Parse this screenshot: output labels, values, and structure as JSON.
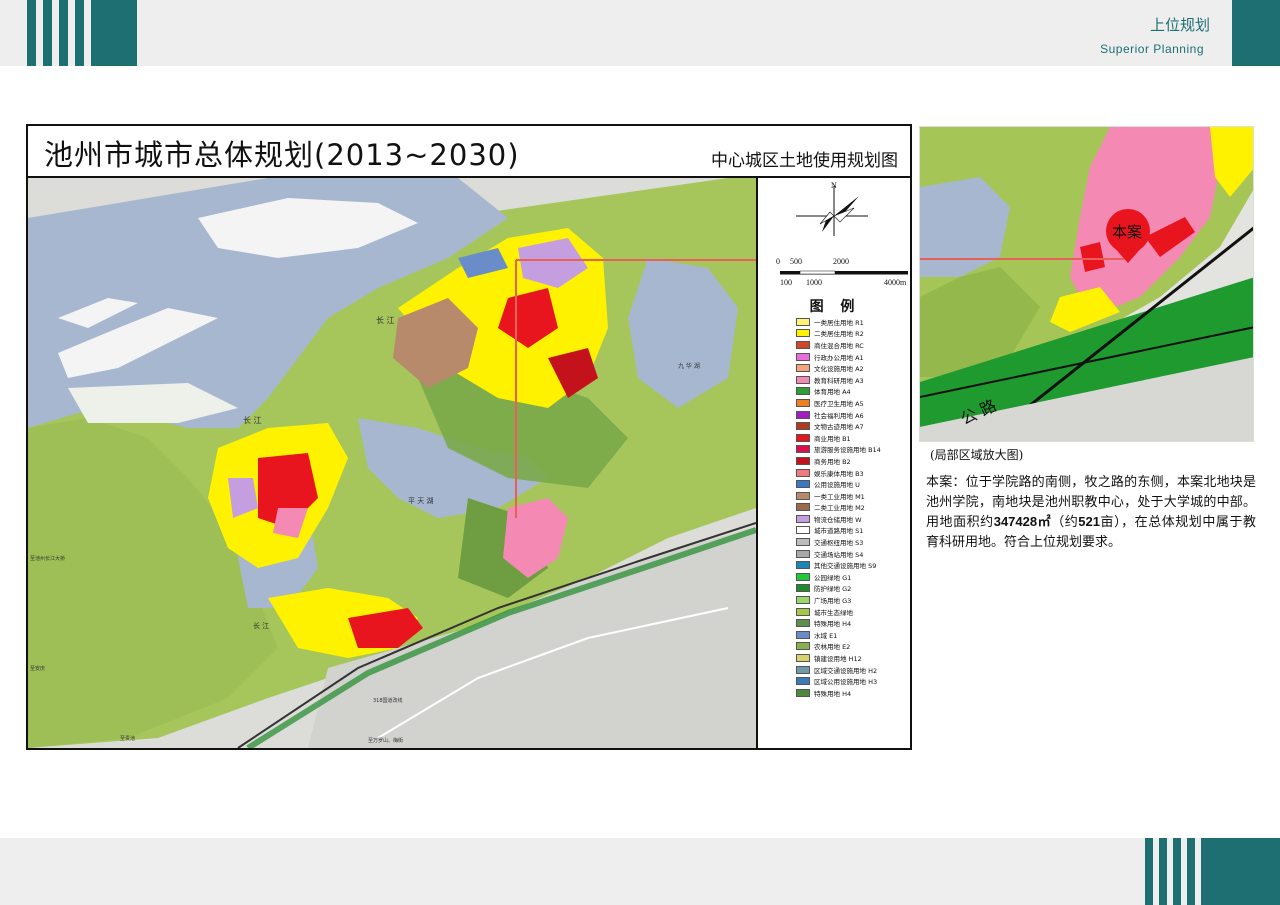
{
  "header": {
    "title_cn": "上位规划",
    "title_en": "Superior Planning"
  },
  "plan": {
    "title": "池州市城市总体规划(2013~2030)",
    "subtitle": "中心城区土地使用规划图",
    "map_labels": {
      "yangtze_1": "长 江",
      "yangtze_2": "长 江",
      "yangtze_3": "长 江",
      "pingtian_lake": "平 天 湖",
      "jiuhua_lake": "九 华 湖",
      "bridge": "至池州长江大桥",
      "guichi": "至贵池",
      "anqing": "至安庆",
      "wanfo": "至万罗山、梅街",
      "highway": "318国道改线"
    },
    "north_label": "N",
    "scale": {
      "top_ticks": [
        "0",
        "500",
        "2000"
      ],
      "bottom_ticks": [
        "100",
        "1000",
        "4000m"
      ]
    },
    "legend_title": "图 例",
    "legend": [
      {
        "label": "一类居住用地 R1",
        "color": "#fff275"
      },
      {
        "label": "二类居住用地 R2",
        "color": "#fff200"
      },
      {
        "label": "商住混合用地 RC",
        "color": "#d0472a"
      },
      {
        "label": "行政办公用地 A1",
        "color": "#e86ee0"
      },
      {
        "label": "文化设施用地 A2",
        "color": "#f5a37a"
      },
      {
        "label": "教育科研用地 A3",
        "color": "#f48ab4"
      },
      {
        "label": "体育用地 A4",
        "color": "#2d9e3a"
      },
      {
        "label": "医疗卫生用地 A5",
        "color": "#f07f22"
      },
      {
        "label": "社会福利用地 A6",
        "color": "#a01fc4"
      },
      {
        "label": "文物古迹用地 A7",
        "color": "#b23a20"
      },
      {
        "label": "商业用地 B1",
        "color": "#e8141e"
      },
      {
        "label": "旅游服务设施用地 B14",
        "color": "#d9114f"
      },
      {
        "label": "商务用地 B2",
        "color": "#c4121c"
      },
      {
        "label": "娱乐康体用地 B3",
        "color": "#f07b7b"
      },
      {
        "label": "公用设施用地 U",
        "color": "#3a78c4"
      },
      {
        "label": "一类工业用地 M1",
        "color": "#b88a6c"
      },
      {
        "label": "二类工业用地 M2",
        "color": "#9a6b4c"
      },
      {
        "label": "物流仓储用地 W",
        "color": "#c59ee0"
      },
      {
        "label": "城市道路用地 S1",
        "color": "#ffffff"
      },
      {
        "label": "交通枢纽用地 S3",
        "color": "#bdbdbd"
      },
      {
        "label": "交通场站用地 S4",
        "color": "#a9a9a9"
      },
      {
        "label": "其他交通设施用地 S9",
        "color": "#1a86b8"
      },
      {
        "label": "公园绿地 G1",
        "color": "#22c93a"
      },
      {
        "label": "防护绿地 G2",
        "color": "#1e8a2a"
      },
      {
        "label": "广场用地 G3",
        "color": "#9ad86b"
      },
      {
        "label": "城市生态绿地",
        "color": "#a6c84a"
      },
      {
        "label": "特殊用地 H4",
        "color": "#5f8f4a"
      },
      {
        "label": "水域 E1",
        "color": "#6a8dc9"
      },
      {
        "label": "农林用地 E2",
        "color": "#8ab04e"
      },
      {
        "label": "镇建设用地 H12",
        "color": "#d8d46a"
      },
      {
        "label": "区域交通设施用地 H2",
        "color": "#6f9aa8"
      },
      {
        "label": "区域公用设施用地 H3",
        "color": "#3c7ab8"
      },
      {
        "label": "特殊用地 H4",
        "color": "#4e8a3a"
      }
    ]
  },
  "zoom": {
    "pin_label": "本案",
    "road_label": "公 路",
    "caption": "(局部区域放大图)"
  },
  "description": {
    "line_a": "本案：位于学院路的南侧，牧之路的东侧，本案北地块是池州学院，南地块是池州职教中心，处于大学城的中部。用地面积约",
    "area": "347428㎡",
    "line_b": "（约",
    "mu": "521",
    "line_c": "亩），在总体规划中属于教育科研用地。符合上位规划要求。"
  },
  "colors": {
    "brand": "#1d6f72",
    "water": "#a6b7cf",
    "green": "#a3c25a",
    "highlight_line": "#e8605a"
  }
}
